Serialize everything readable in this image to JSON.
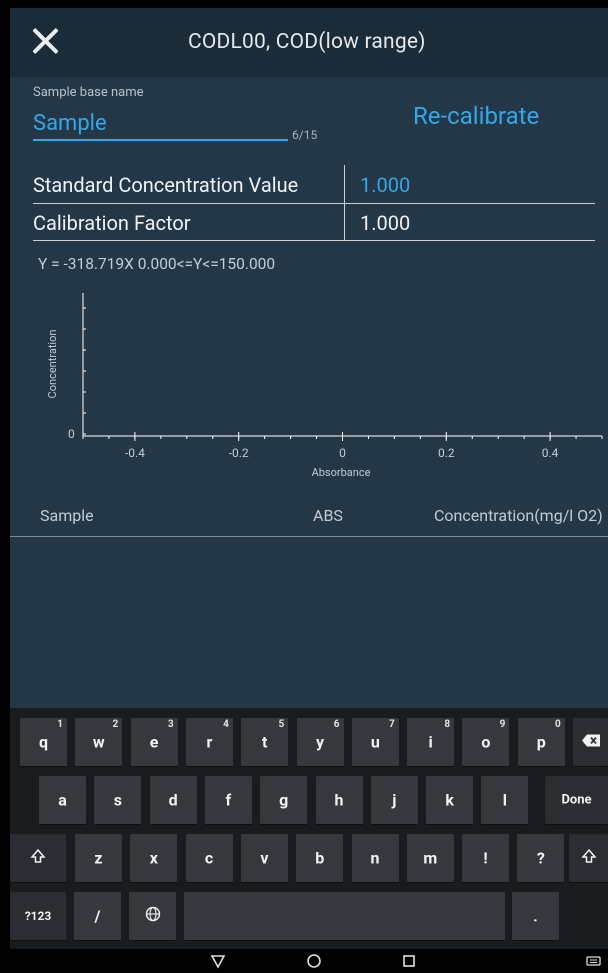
{
  "header": {
    "title": "CODL00, COD(low range)"
  },
  "sample": {
    "label": "Sample base name",
    "value": "Sample",
    "counter": "6/15"
  },
  "recalibrate_label": "Re-calibrate",
  "table": {
    "rows": [
      {
        "label": "Standard Concentration Value",
        "value": "1.000"
      },
      {
        "label": "Calibration Factor",
        "value": "1.000"
      }
    ]
  },
  "equation": "Y = -318.719X   0.000<=Y<=150.000",
  "chart_data": {
    "type": "line",
    "xlabel": "Absorbance",
    "ylabel": "Concentration",
    "xlim": [
      -0.5,
      0.5
    ],
    "x_ticks": [
      "-0.4",
      "-0.2",
      "0",
      "0.2",
      "0.4"
    ],
    "y_ticks": [
      "0"
    ],
    "series": [],
    "grid": false
  },
  "list_headers": {
    "sample": "Sample",
    "abs": "ABS",
    "concentration": "Concentration(mg/l O2)"
  },
  "keyboard": {
    "row1": [
      {
        "k": "q",
        "n": "1"
      },
      {
        "k": "w",
        "n": "2"
      },
      {
        "k": "e",
        "n": "3"
      },
      {
        "k": "r",
        "n": "4"
      },
      {
        "k": "t",
        "n": "5"
      },
      {
        "k": "y",
        "n": "6"
      },
      {
        "k": "u",
        "n": "7"
      },
      {
        "k": "i",
        "n": "8"
      },
      {
        "k": "o",
        "n": "9"
      },
      {
        "k": "p",
        "n": "0"
      }
    ],
    "row2": [
      "a",
      "s",
      "d",
      "f",
      "g",
      "h",
      "j",
      "k",
      "l"
    ],
    "row3": [
      "z",
      "x",
      "c",
      "v",
      "b",
      "n",
      "m",
      "!",
      "?"
    ],
    "done_label": "Done",
    "sym_label": "?123",
    "slash_label": "/",
    "period_label": ".",
    "icons": {
      "backspace": "backspace-icon",
      "shift": "shift-icon",
      "globe": "globe-icon"
    }
  },
  "navbar": {
    "icons": [
      "back-icon",
      "home-icon",
      "recents-icon",
      "keyboard-icon"
    ]
  }
}
